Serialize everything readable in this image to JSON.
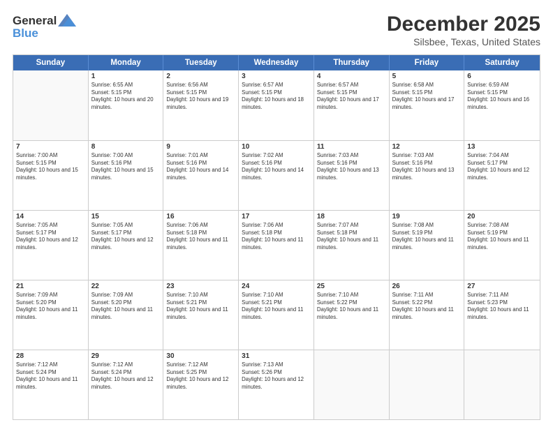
{
  "logo": {
    "general": "General",
    "blue": "Blue"
  },
  "title": "December 2025",
  "location": "Silsbee, Texas, United States",
  "days": [
    "Sunday",
    "Monday",
    "Tuesday",
    "Wednesday",
    "Thursday",
    "Friday",
    "Saturday"
  ],
  "weeks": [
    [
      {
        "day": "",
        "sunrise": "",
        "sunset": "",
        "daylight": ""
      },
      {
        "day": "1",
        "sunrise": "Sunrise: 6:55 AM",
        "sunset": "Sunset: 5:15 PM",
        "daylight": "Daylight: 10 hours and 20 minutes."
      },
      {
        "day": "2",
        "sunrise": "Sunrise: 6:56 AM",
        "sunset": "Sunset: 5:15 PM",
        "daylight": "Daylight: 10 hours and 19 minutes."
      },
      {
        "day": "3",
        "sunrise": "Sunrise: 6:57 AM",
        "sunset": "Sunset: 5:15 PM",
        "daylight": "Daylight: 10 hours and 18 minutes."
      },
      {
        "day": "4",
        "sunrise": "Sunrise: 6:57 AM",
        "sunset": "Sunset: 5:15 PM",
        "daylight": "Daylight: 10 hours and 17 minutes."
      },
      {
        "day": "5",
        "sunrise": "Sunrise: 6:58 AM",
        "sunset": "Sunset: 5:15 PM",
        "daylight": "Daylight: 10 hours and 17 minutes."
      },
      {
        "day": "6",
        "sunrise": "Sunrise: 6:59 AM",
        "sunset": "Sunset: 5:15 PM",
        "daylight": "Daylight: 10 hours and 16 minutes."
      }
    ],
    [
      {
        "day": "7",
        "sunrise": "Sunrise: 7:00 AM",
        "sunset": "Sunset: 5:15 PM",
        "daylight": "Daylight: 10 hours and 15 minutes."
      },
      {
        "day": "8",
        "sunrise": "Sunrise: 7:00 AM",
        "sunset": "Sunset: 5:16 PM",
        "daylight": "Daylight: 10 hours and 15 minutes."
      },
      {
        "day": "9",
        "sunrise": "Sunrise: 7:01 AM",
        "sunset": "Sunset: 5:16 PM",
        "daylight": "Daylight: 10 hours and 14 minutes."
      },
      {
        "day": "10",
        "sunrise": "Sunrise: 7:02 AM",
        "sunset": "Sunset: 5:16 PM",
        "daylight": "Daylight: 10 hours and 14 minutes."
      },
      {
        "day": "11",
        "sunrise": "Sunrise: 7:03 AM",
        "sunset": "Sunset: 5:16 PM",
        "daylight": "Daylight: 10 hours and 13 minutes."
      },
      {
        "day": "12",
        "sunrise": "Sunrise: 7:03 AM",
        "sunset": "Sunset: 5:16 PM",
        "daylight": "Daylight: 10 hours and 13 minutes."
      },
      {
        "day": "13",
        "sunrise": "Sunrise: 7:04 AM",
        "sunset": "Sunset: 5:17 PM",
        "daylight": "Daylight: 10 hours and 12 minutes."
      }
    ],
    [
      {
        "day": "14",
        "sunrise": "Sunrise: 7:05 AM",
        "sunset": "Sunset: 5:17 PM",
        "daylight": "Daylight: 10 hours and 12 minutes."
      },
      {
        "day": "15",
        "sunrise": "Sunrise: 7:05 AM",
        "sunset": "Sunset: 5:17 PM",
        "daylight": "Daylight: 10 hours and 12 minutes."
      },
      {
        "day": "16",
        "sunrise": "Sunrise: 7:06 AM",
        "sunset": "Sunset: 5:18 PM",
        "daylight": "Daylight: 10 hours and 11 minutes."
      },
      {
        "day": "17",
        "sunrise": "Sunrise: 7:06 AM",
        "sunset": "Sunset: 5:18 PM",
        "daylight": "Daylight: 10 hours and 11 minutes."
      },
      {
        "day": "18",
        "sunrise": "Sunrise: 7:07 AM",
        "sunset": "Sunset: 5:18 PM",
        "daylight": "Daylight: 10 hours and 11 minutes."
      },
      {
        "day": "19",
        "sunrise": "Sunrise: 7:08 AM",
        "sunset": "Sunset: 5:19 PM",
        "daylight": "Daylight: 10 hours and 11 minutes."
      },
      {
        "day": "20",
        "sunrise": "Sunrise: 7:08 AM",
        "sunset": "Sunset: 5:19 PM",
        "daylight": "Daylight: 10 hours and 11 minutes."
      }
    ],
    [
      {
        "day": "21",
        "sunrise": "Sunrise: 7:09 AM",
        "sunset": "Sunset: 5:20 PM",
        "daylight": "Daylight: 10 hours and 11 minutes."
      },
      {
        "day": "22",
        "sunrise": "Sunrise: 7:09 AM",
        "sunset": "Sunset: 5:20 PM",
        "daylight": "Daylight: 10 hours and 11 minutes."
      },
      {
        "day": "23",
        "sunrise": "Sunrise: 7:10 AM",
        "sunset": "Sunset: 5:21 PM",
        "daylight": "Daylight: 10 hours and 11 minutes."
      },
      {
        "day": "24",
        "sunrise": "Sunrise: 7:10 AM",
        "sunset": "Sunset: 5:21 PM",
        "daylight": "Daylight: 10 hours and 11 minutes."
      },
      {
        "day": "25",
        "sunrise": "Sunrise: 7:10 AM",
        "sunset": "Sunset: 5:22 PM",
        "daylight": "Daylight: 10 hours and 11 minutes."
      },
      {
        "day": "26",
        "sunrise": "Sunrise: 7:11 AM",
        "sunset": "Sunset: 5:22 PM",
        "daylight": "Daylight: 10 hours and 11 minutes."
      },
      {
        "day": "27",
        "sunrise": "Sunrise: 7:11 AM",
        "sunset": "Sunset: 5:23 PM",
        "daylight": "Daylight: 10 hours and 11 minutes."
      }
    ],
    [
      {
        "day": "28",
        "sunrise": "Sunrise: 7:12 AM",
        "sunset": "Sunset: 5:24 PM",
        "daylight": "Daylight: 10 hours and 11 minutes."
      },
      {
        "day": "29",
        "sunrise": "Sunrise: 7:12 AM",
        "sunset": "Sunset: 5:24 PM",
        "daylight": "Daylight: 10 hours and 12 minutes."
      },
      {
        "day": "30",
        "sunrise": "Sunrise: 7:12 AM",
        "sunset": "Sunset: 5:25 PM",
        "daylight": "Daylight: 10 hours and 12 minutes."
      },
      {
        "day": "31",
        "sunrise": "Sunrise: 7:13 AM",
        "sunset": "Sunset: 5:26 PM",
        "daylight": "Daylight: 10 hours and 12 minutes."
      },
      {
        "day": "",
        "sunrise": "",
        "sunset": "",
        "daylight": ""
      },
      {
        "day": "",
        "sunrise": "",
        "sunset": "",
        "daylight": ""
      },
      {
        "day": "",
        "sunrise": "",
        "sunset": "",
        "daylight": ""
      }
    ]
  ]
}
